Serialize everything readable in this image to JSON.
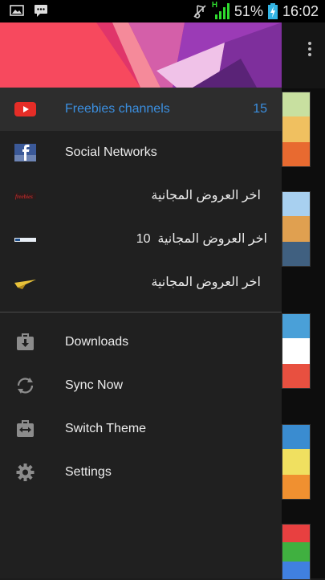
{
  "status_bar": {
    "battery_percent": "51%",
    "time": "16:02",
    "network_type": "H",
    "left_icons": [
      "image-notification-icon",
      "message-notification-icon"
    ],
    "right_icons": [
      "mute-icon",
      "signal-icon",
      "battery-icon"
    ]
  },
  "drawer": {
    "channels": [
      {
        "label": "Freebies channels",
        "count": "15",
        "icon": "youtube-icon",
        "active": true
      },
      {
        "label": "Social Networks",
        "icon": "facebook-icon"
      }
    ],
    "feeds": [
      {
        "label": "اخر العروض المجانية",
        "icon": "freebies-logo-icon"
      },
      {
        "label": "اخر العروض المجانية",
        "count": "10",
        "icon": "banner-logo-icon"
      },
      {
        "label": "اخر العروض المجانية",
        "icon": "plane-logo-icon"
      }
    ],
    "menu": [
      {
        "label": "Downloads",
        "icon": "downloads-icon"
      },
      {
        "label": "Sync Now",
        "icon": "sync-icon"
      },
      {
        "label": "Switch Theme",
        "icon": "switch-theme-icon"
      },
      {
        "label": "Settings",
        "icon": "settings-icon"
      }
    ]
  },
  "colors": {
    "accent": "#3b8fe0",
    "drawer_bg": "#202020",
    "active_row_bg": "#2d2d2d",
    "header_left": "#f7495e",
    "header_right": "#9b3bb6"
  }
}
